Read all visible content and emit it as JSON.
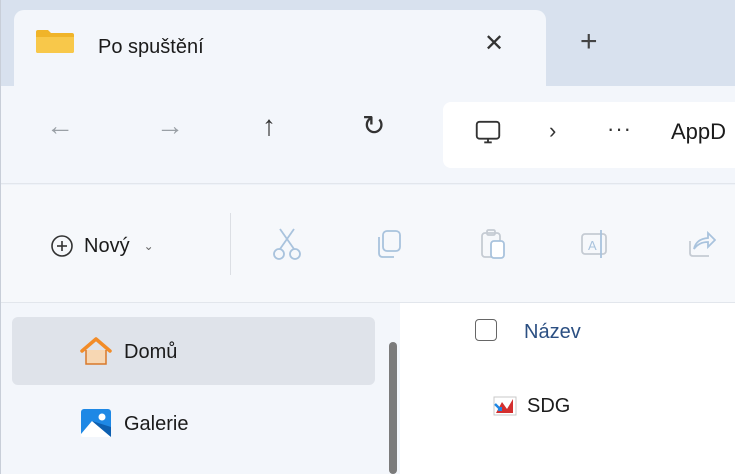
{
  "tab": {
    "title": "Po spuštění",
    "close_glyph": "✕",
    "new_tab_glyph": "+",
    "icon": "folder-icon"
  },
  "nav": {
    "back_glyph": "←",
    "forward_glyph": "→",
    "up_glyph": "↑",
    "refresh_glyph": "↻",
    "breadcrumb_sep": "›",
    "breadcrumb_more": "···",
    "breadcrumb_text": "AppD"
  },
  "command_bar": {
    "new_label": "Nový",
    "new_caret": "⌄",
    "icons": [
      "cut-icon",
      "copy-icon",
      "paste-icon",
      "rename-icon",
      "share-icon"
    ]
  },
  "sidebar": {
    "items": [
      {
        "label": "Domů",
        "icon": "home-icon",
        "selected": true
      },
      {
        "label": "Galerie",
        "icon": "gallery-icon",
        "selected": false
      }
    ]
  },
  "file_list": {
    "column_name": "Název",
    "files": [
      {
        "name": "SDG",
        "icon": "sdg-app-icon"
      }
    ]
  },
  "colors": {
    "tabstrip": "#d8e1ee",
    "tab_active": "#f3f6fb",
    "folder": "#f4b400",
    "home_roof": "#f28c28",
    "gallery": "#1e88e5",
    "column_header": "#2b4f82"
  }
}
